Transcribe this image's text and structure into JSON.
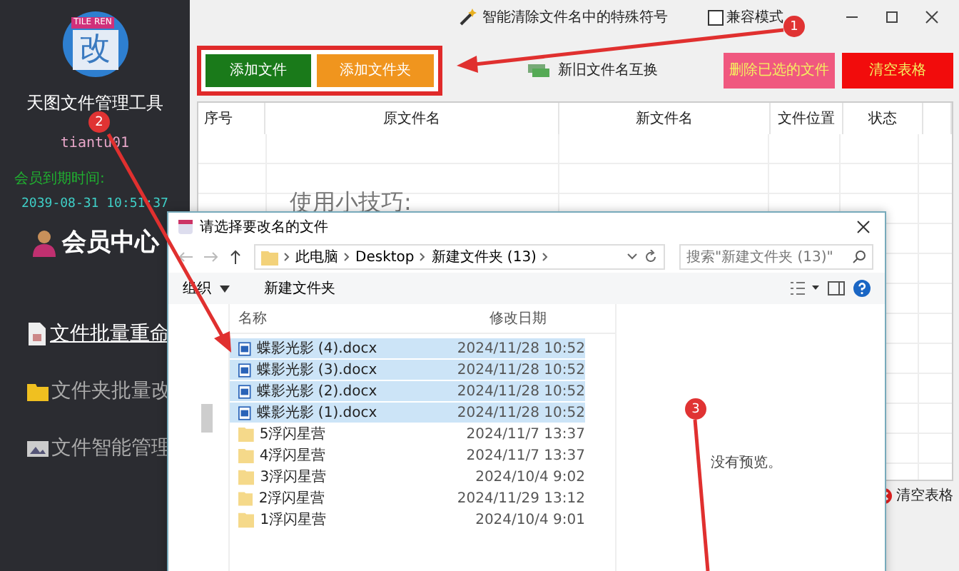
{
  "sidebar": {
    "logo_text": "改",
    "logo_banner": "TILE REN",
    "app_name": "天图文件管理工具",
    "username": "tiantu01",
    "expiry_label": "会员到期时间:",
    "expiry_date": "2039-08-31 10:51:37",
    "member_center": "会员中心",
    "nav": [
      {
        "label": "文件批量重命",
        "kind": "document",
        "selected": true
      },
      {
        "label": "文件夹批量改",
        "kind": "folder",
        "selected": false
      },
      {
        "label": "文件智能管理",
        "kind": "gallery",
        "selected": false
      }
    ]
  },
  "topbar": {
    "special_chars": "智能清除文件名中的特殊符号",
    "compat_mode": {
      "label": "兼容模式",
      "checked": false
    }
  },
  "add_buttons": [
    {
      "label": "添加文件",
      "color": "#1a7a1a"
    },
    {
      "label": "添加文件夹",
      "color": "#f0951e"
    }
  ],
  "swap_button": "新旧文件名互换",
  "right_buttons": [
    {
      "label": "删除已选的文件",
      "color": "#f0587f"
    },
    {
      "label": "清空表格",
      "color": "#f20c0c"
    }
  ],
  "table": {
    "columns": [
      "序号",
      "原文件名",
      "新文件名",
      "文件位置",
      "状态"
    ],
    "tip": "使用小技巧:"
  },
  "clear_table_link": "清空表格",
  "dialog": {
    "title": "请选择要改名的文件",
    "breadcrumb": [
      "此电脑",
      "Desktop",
      "新建文件夹 (13)"
    ],
    "search_placeholder": "搜索\"新建文件夹 (13)\"",
    "organize": "组织",
    "new_folder": "新建文件夹",
    "columns": [
      "名称",
      "修改日期"
    ],
    "files": [
      {
        "name": "蝶影光影 (4).docx",
        "date": "2024/11/28 10:52",
        "kind": "docx",
        "selected": true
      },
      {
        "name": "蝶影光影 (3).docx",
        "date": "2024/11/28 10:52",
        "kind": "docx",
        "selected": true
      },
      {
        "name": "蝶影光影 (2).docx",
        "date": "2024/11/28 10:52",
        "kind": "docx",
        "selected": true
      },
      {
        "name": "蝶影光影 (1).docx",
        "date": "2024/11/28 10:52",
        "kind": "docx",
        "selected": true
      },
      {
        "name": "5浮闪星营",
        "date": "2024/11/7 13:37",
        "kind": "folder",
        "selected": false
      },
      {
        "name": "4浮闪星营",
        "date": "2024/11/7 13:37",
        "kind": "folder",
        "selected": false
      },
      {
        "name": "3浮闪星营",
        "date": "2024/10/4 9:02",
        "kind": "folder",
        "selected": false
      },
      {
        "name": "2浮闪星营",
        "date": "2024/11/29 13:12",
        "kind": "folder",
        "selected": false
      },
      {
        "name": "1浮闪星营",
        "date": "2024/10/4 9:01",
        "kind": "folder",
        "selected": false
      }
    ],
    "preview": "没有预览。"
  },
  "annotations": [
    "1",
    "2",
    "3"
  ]
}
